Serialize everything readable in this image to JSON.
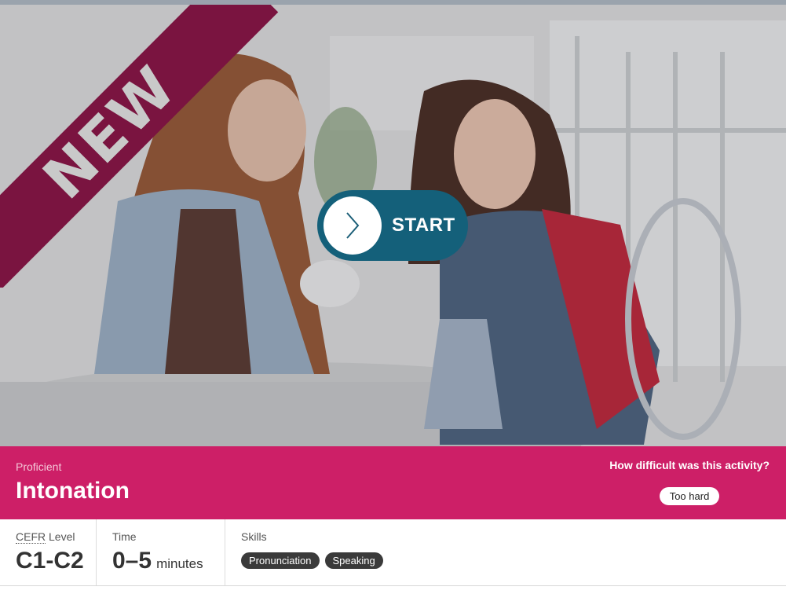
{
  "hero": {
    "ribbon_text": "NEW",
    "image_alt": "",
    "colors": {
      "ribbon": "#7a1440",
      "start_button": "#14607a"
    },
    "start": {
      "label": "START",
      "icon": "chevron-right-icon"
    }
  },
  "activity": {
    "level": "Proficient",
    "title": "Intonation",
    "difficulty_question": "How difficult was this activity?",
    "difficulty_answer": "Too hard",
    "accent_color": "#cd1f67"
  },
  "meta": {
    "cefr": {
      "abbr": "CEFR",
      "label_rest": " Level",
      "value": "C1-C2"
    },
    "time": {
      "label": "Time",
      "value": "0–5",
      "unit": "minutes"
    },
    "skills": {
      "label": "Skills",
      "items": [
        "Pronunciation",
        "Speaking"
      ]
    }
  }
}
